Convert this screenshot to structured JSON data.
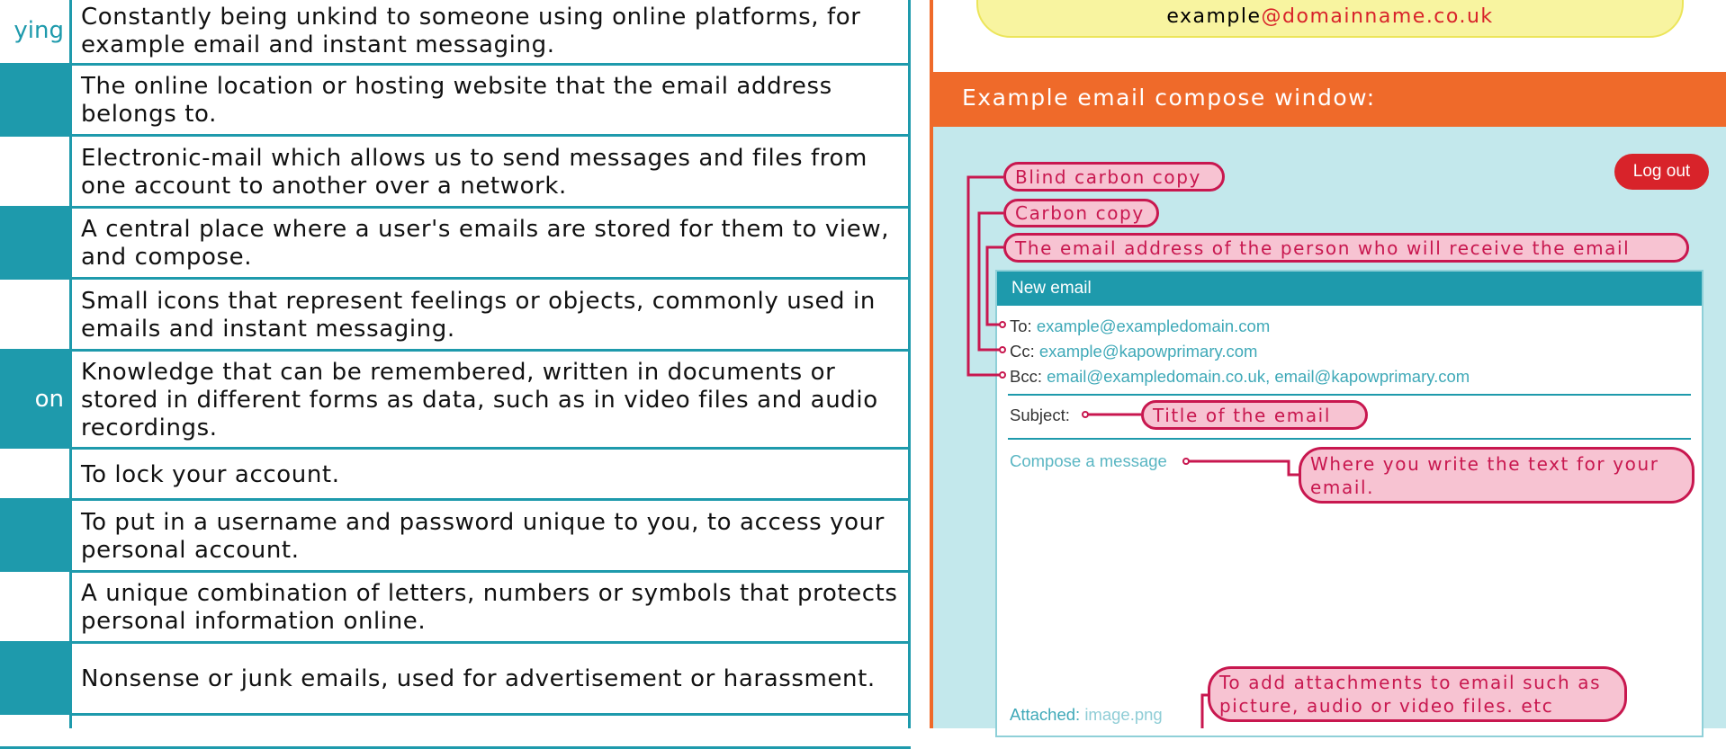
{
  "glossary": {
    "rows": [
      {
        "term": "ying",
        "definition": "Constantly being unkind to someone using online platforms, for example email and instant messaging."
      },
      {
        "term": "",
        "definition": "The online location or hosting website that the email address belongs to."
      },
      {
        "term": "",
        "definition": "Electronic-mail which allows us to send messages and files from one account to another over a network."
      },
      {
        "term": "",
        "definition": "A central place where a user's emails are stored for them to view, and compose."
      },
      {
        "term": "",
        "definition": "Small icons that represent feelings or objects, commonly used in emails and instant messaging."
      },
      {
        "term": "on",
        "definition": "Knowledge that can be remembered, written in documents or stored in different forms as data, such as in video files and audio recordings."
      },
      {
        "term": "",
        "definition": "To lock your account."
      },
      {
        "term": "",
        "definition": "To put in a username and password unique to you, to access your personal account."
      },
      {
        "term": "",
        "definition": "A unique combination of letters, numbers or symbols that protects personal information online."
      },
      {
        "term": "",
        "definition": "Nonsense or junk emails, used for advertisement or harassment."
      },
      {
        "term": "",
        "definition": ""
      }
    ]
  },
  "example_address": {
    "local": "example",
    "domain": "@domainname.co.uk"
  },
  "compose_section": {
    "title": "Example email compose window:",
    "logout_label": "Log out",
    "window_title": "New email",
    "to_label": "To:",
    "to_value": "example@exampledomain.com",
    "cc_label": "Cc:",
    "cc_value": "example@kapowprimary.com",
    "bcc_label": "Bcc:",
    "bcc_value": "email@exampledomain.co.uk, email@kapowprimary.com",
    "subject_label": "Subject:",
    "compose_placeholder": "Compose a message",
    "attached_label": "Attached:",
    "attached_value": "image.png"
  },
  "annotations": {
    "bcc": "Blind carbon copy",
    "cc": "Carbon copy",
    "to": "The email address of the person who will receive the email",
    "subject": "Title of the email",
    "body": "Where you write the text for your email.",
    "attachment": "To add attachments to email such as picture, audio or video files. etc"
  },
  "colors": {
    "teal": "#1e9aac",
    "orange": "#ef6a2a",
    "pink": "#f7c3d2",
    "crimson": "#c8174f",
    "logout_red": "#d8232a",
    "yellow": "#f8f4a0"
  }
}
